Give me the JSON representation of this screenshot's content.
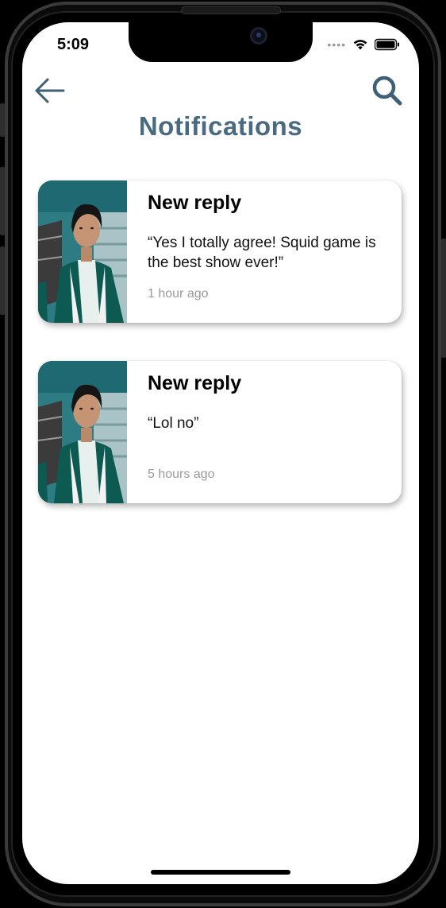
{
  "status_bar": {
    "time": "5:09"
  },
  "header": {
    "title": "Notifications"
  },
  "notifications": [
    {
      "title": "New reply",
      "text": "“Yes I totally agree! Squid game is the best show ever!”",
      "time": "1 hour ago"
    },
    {
      "title": "New reply",
      "text": "“Lol no”",
      "time": "5 hours ago"
    }
  ],
  "colors": {
    "title": "#4a6a82",
    "icon": "#3e5f75",
    "timestamp": "#9a9a9a"
  },
  "icons": {
    "back": "arrow-left-icon",
    "search": "search-icon",
    "wifi": "wifi-icon",
    "battery": "battery-icon",
    "signal": "signal-dots-icon"
  }
}
